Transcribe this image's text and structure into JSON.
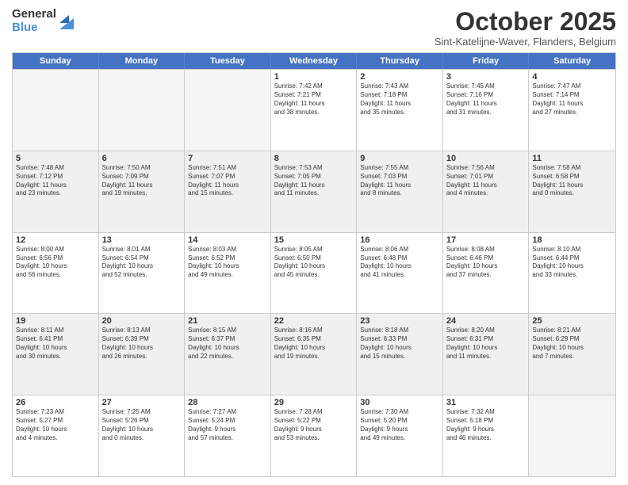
{
  "logo": {
    "general": "General",
    "blue": "Blue"
  },
  "title": "October 2025",
  "location": "Sint-Katelijne-Waver, Flanders, Belgium",
  "days_of_week": [
    "Sunday",
    "Monday",
    "Tuesday",
    "Wednesday",
    "Thursday",
    "Friday",
    "Saturday"
  ],
  "weeks": [
    [
      {
        "day": "",
        "text": "",
        "empty": true
      },
      {
        "day": "",
        "text": "",
        "empty": true
      },
      {
        "day": "",
        "text": "",
        "empty": true
      },
      {
        "day": "1",
        "text": "Sunrise: 7:42 AM\nSunset: 7:21 PM\nDaylight: 11 hours\nand 38 minutes.",
        "empty": false
      },
      {
        "day": "2",
        "text": "Sunrise: 7:43 AM\nSunset: 7:18 PM\nDaylight: 11 hours\nand 35 minutes.",
        "empty": false
      },
      {
        "day": "3",
        "text": "Sunrise: 7:45 AM\nSunset: 7:16 PM\nDaylight: 11 hours\nand 31 minutes.",
        "empty": false
      },
      {
        "day": "4",
        "text": "Sunrise: 7:47 AM\nSunset: 7:14 PM\nDaylight: 11 hours\nand 27 minutes.",
        "empty": false
      }
    ],
    [
      {
        "day": "5",
        "text": "Sunrise: 7:48 AM\nSunset: 7:12 PM\nDaylight: 11 hours\nand 23 minutes.",
        "empty": false
      },
      {
        "day": "6",
        "text": "Sunrise: 7:50 AM\nSunset: 7:09 PM\nDaylight: 11 hours\nand 19 minutes.",
        "empty": false
      },
      {
        "day": "7",
        "text": "Sunrise: 7:51 AM\nSunset: 7:07 PM\nDaylight: 11 hours\nand 15 minutes.",
        "empty": false
      },
      {
        "day": "8",
        "text": "Sunrise: 7:53 AM\nSunset: 7:05 PM\nDaylight: 11 hours\nand 11 minutes.",
        "empty": false
      },
      {
        "day": "9",
        "text": "Sunrise: 7:55 AM\nSunset: 7:03 PM\nDaylight: 11 hours\nand 8 minutes.",
        "empty": false
      },
      {
        "day": "10",
        "text": "Sunrise: 7:56 AM\nSunset: 7:01 PM\nDaylight: 11 hours\nand 4 minutes.",
        "empty": false
      },
      {
        "day": "11",
        "text": "Sunrise: 7:58 AM\nSunset: 6:58 PM\nDaylight: 11 hours\nand 0 minutes.",
        "empty": false
      }
    ],
    [
      {
        "day": "12",
        "text": "Sunrise: 8:00 AM\nSunset: 6:56 PM\nDaylight: 10 hours\nand 56 minutes.",
        "empty": false
      },
      {
        "day": "13",
        "text": "Sunrise: 8:01 AM\nSunset: 6:54 PM\nDaylight: 10 hours\nand 52 minutes.",
        "empty": false
      },
      {
        "day": "14",
        "text": "Sunrise: 8:03 AM\nSunset: 6:52 PM\nDaylight: 10 hours\nand 49 minutes.",
        "empty": false
      },
      {
        "day": "15",
        "text": "Sunrise: 8:05 AM\nSunset: 6:50 PM\nDaylight: 10 hours\nand 45 minutes.",
        "empty": false
      },
      {
        "day": "16",
        "text": "Sunrise: 8:06 AM\nSunset: 6:48 PM\nDaylight: 10 hours\nand 41 minutes.",
        "empty": false
      },
      {
        "day": "17",
        "text": "Sunrise: 8:08 AM\nSunset: 6:46 PM\nDaylight: 10 hours\nand 37 minutes.",
        "empty": false
      },
      {
        "day": "18",
        "text": "Sunrise: 8:10 AM\nSunset: 6:44 PM\nDaylight: 10 hours\nand 33 minutes.",
        "empty": false
      }
    ],
    [
      {
        "day": "19",
        "text": "Sunrise: 8:11 AM\nSunset: 6:41 PM\nDaylight: 10 hours\nand 30 minutes.",
        "empty": false
      },
      {
        "day": "20",
        "text": "Sunrise: 8:13 AM\nSunset: 6:39 PM\nDaylight: 10 hours\nand 26 minutes.",
        "empty": false
      },
      {
        "day": "21",
        "text": "Sunrise: 8:15 AM\nSunset: 6:37 PM\nDaylight: 10 hours\nand 22 minutes.",
        "empty": false
      },
      {
        "day": "22",
        "text": "Sunrise: 8:16 AM\nSunset: 6:35 PM\nDaylight: 10 hours\nand 19 minutes.",
        "empty": false
      },
      {
        "day": "23",
        "text": "Sunrise: 8:18 AM\nSunset: 6:33 PM\nDaylight: 10 hours\nand 15 minutes.",
        "empty": false
      },
      {
        "day": "24",
        "text": "Sunrise: 8:20 AM\nSunset: 6:31 PM\nDaylight: 10 hours\nand 11 minutes.",
        "empty": false
      },
      {
        "day": "25",
        "text": "Sunrise: 8:21 AM\nSunset: 6:29 PM\nDaylight: 10 hours\nand 7 minutes.",
        "empty": false
      }
    ],
    [
      {
        "day": "26",
        "text": "Sunrise: 7:23 AM\nSunset: 5:27 PM\nDaylight: 10 hours\nand 4 minutes.",
        "empty": false
      },
      {
        "day": "27",
        "text": "Sunrise: 7:25 AM\nSunset: 5:26 PM\nDaylight: 10 hours\nand 0 minutes.",
        "empty": false
      },
      {
        "day": "28",
        "text": "Sunrise: 7:27 AM\nSunset: 5:24 PM\nDaylight: 9 hours\nand 57 minutes.",
        "empty": false
      },
      {
        "day": "29",
        "text": "Sunrise: 7:28 AM\nSunset: 5:22 PM\nDaylight: 9 hours\nand 53 minutes.",
        "empty": false
      },
      {
        "day": "30",
        "text": "Sunrise: 7:30 AM\nSunset: 5:20 PM\nDaylight: 9 hours\nand 49 minutes.",
        "empty": false
      },
      {
        "day": "31",
        "text": "Sunrise: 7:32 AM\nSunset: 5:18 PM\nDaylight: 9 hours\nand 46 minutes.",
        "empty": false
      },
      {
        "day": "",
        "text": "",
        "empty": true
      }
    ]
  ]
}
